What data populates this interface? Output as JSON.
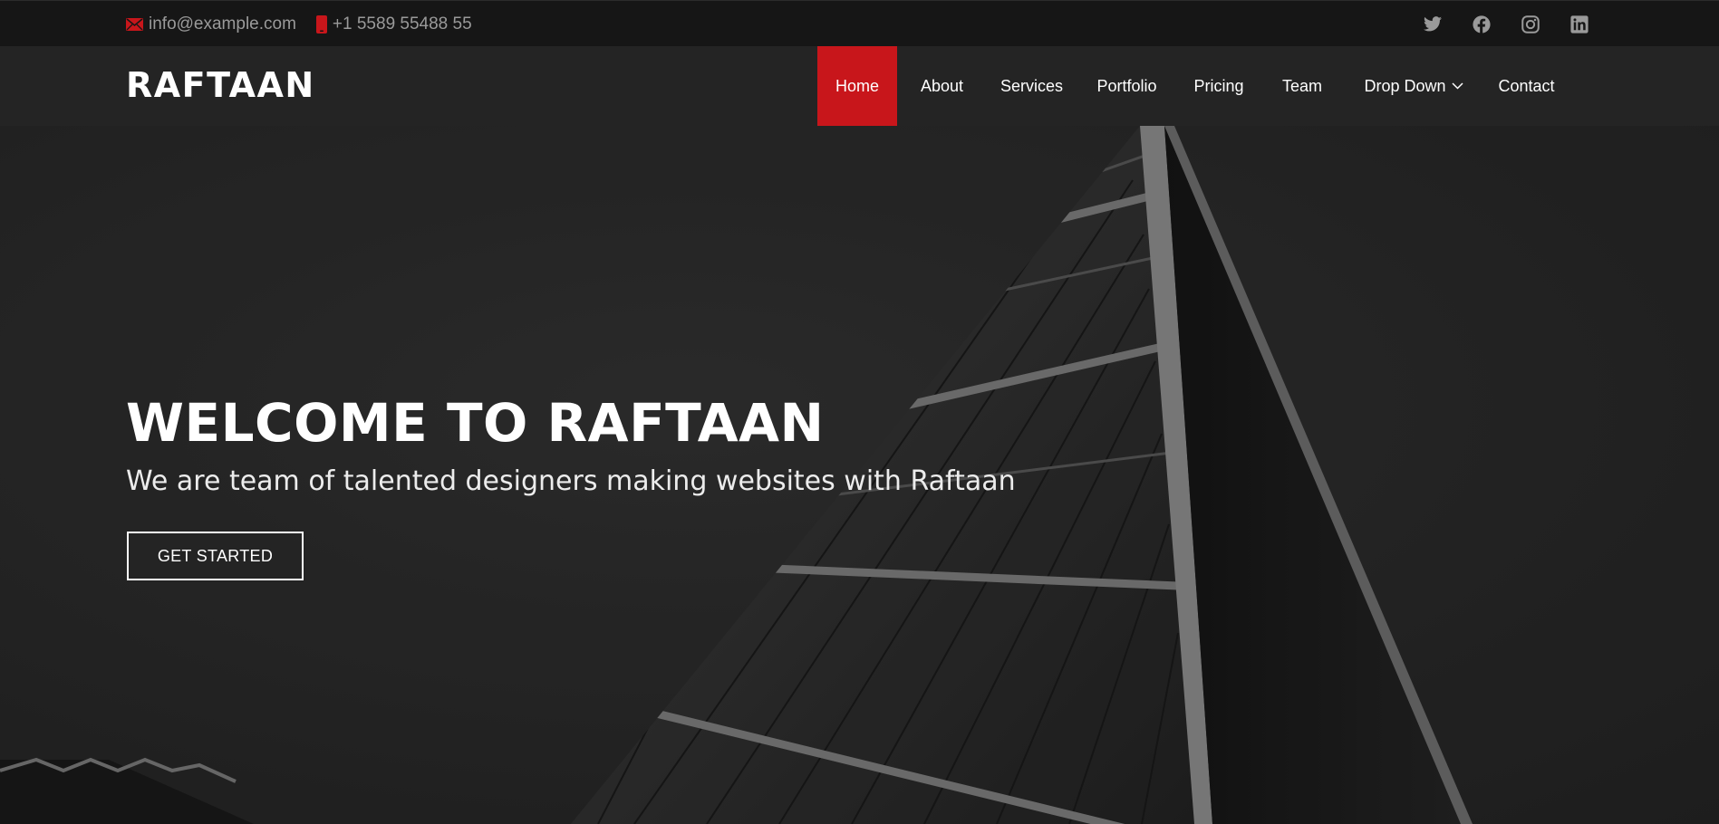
{
  "topbar": {
    "email": "info@example.com",
    "phone": "+1 5589 55488 55",
    "email_icon": "envelope-icon",
    "phone_icon": "phone-icon",
    "social": [
      "twitter-icon",
      "facebook-icon",
      "instagram-icon",
      "linkedin-icon"
    ]
  },
  "header": {
    "logo": "RAFTAAN",
    "nav": [
      {
        "label": "Home",
        "active": true
      },
      {
        "label": "About"
      },
      {
        "label": "Services"
      },
      {
        "label": "Portfolio"
      },
      {
        "label": "Pricing"
      },
      {
        "label": "Team"
      },
      {
        "label": "Drop Down",
        "dropdown": true
      },
      {
        "label": "Contact"
      }
    ]
  },
  "hero": {
    "title": "WELCOME TO RAFTAAN",
    "subtitle": "We are team of talented designers making websites with Raftaan",
    "button": "GET STARTED"
  },
  "colors": {
    "accent": "#c8161b",
    "topbar_bg": "#161616",
    "header_bg": "#242424",
    "hero_bg": "#262626"
  }
}
